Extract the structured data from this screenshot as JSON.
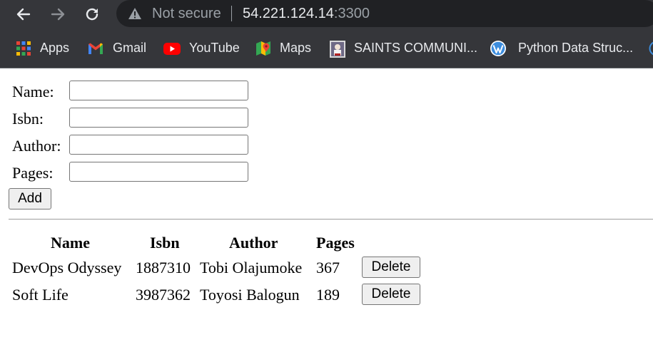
{
  "browser": {
    "security_text": "Not secure",
    "url_host": "54.221.124.14",
    "url_port": ":3300"
  },
  "bookmarks": [
    {
      "label": "Apps",
      "icon": "apps-grid-icon"
    },
    {
      "label": "Gmail",
      "icon": "gmail-icon"
    },
    {
      "label": "YouTube",
      "icon": "youtube-icon"
    },
    {
      "label": "Maps",
      "icon": "maps-icon"
    },
    {
      "label": "SAINTS COMMUNI...",
      "icon": "saints-community-icon"
    },
    {
      "label": "Python  Data Struc...",
      "icon": "wordpress-icon"
    }
  ],
  "form": {
    "name_label": "Name:",
    "isbn_label": "Isbn:",
    "author_label": "Author:",
    "pages_label": "Pages:",
    "name_value": "",
    "isbn_value": "",
    "author_value": "",
    "pages_value": "",
    "add_label": "Add"
  },
  "table": {
    "headers": [
      "Name",
      "Isbn",
      "Author",
      "Pages"
    ],
    "rows": [
      {
        "name": "DevOps Odyssey",
        "isbn": "1887310",
        "author": "Tobi Olajumoke",
        "pages": "367",
        "delete_label": "Delete"
      },
      {
        "name": "Soft Life",
        "isbn": "3987362",
        "author": "Toyosi Balogun",
        "pages": "189",
        "delete_label": "Delete"
      }
    ]
  },
  "colors": {
    "chrome_bg": "#35363a",
    "omnibox_bg": "#202124",
    "youtube_red": "#ff0000",
    "wordpress_blue": "#3c8dde"
  }
}
